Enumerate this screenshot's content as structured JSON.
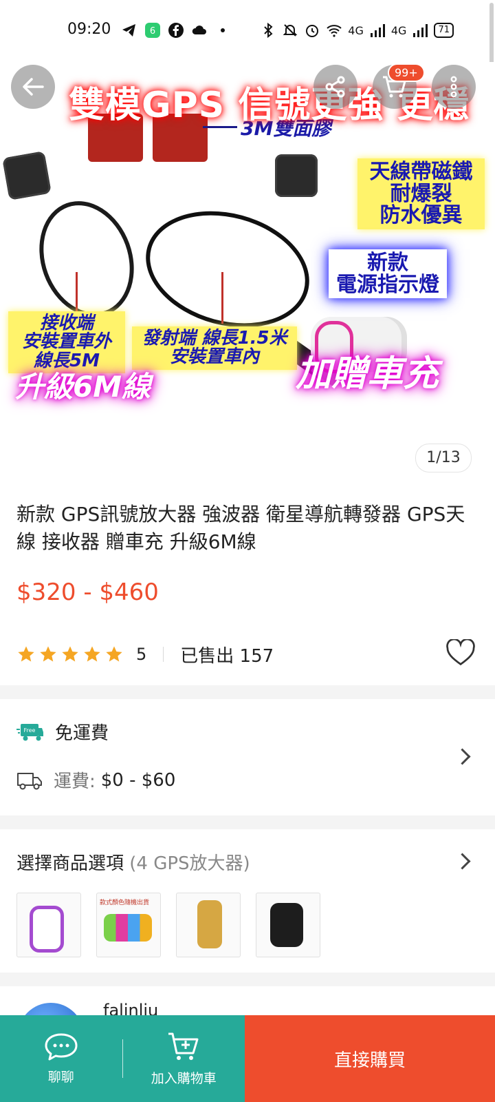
{
  "status_bar": {
    "time": "09:20",
    "battery": "71",
    "network_1": "4G",
    "network_2": "4G"
  },
  "hero": {
    "headline": "雙模GPS 信號更強 更穩",
    "label_tape": "3M雙面膠",
    "label_antenna_lines": [
      "天線帶磁鐵",
      "耐爆裂",
      "防水優異"
    ],
    "label_newlight_lines": [
      "新款",
      "電源指示燈"
    ],
    "label_receive_lines": [
      "接收端",
      "安裝置車外",
      "線長5M"
    ],
    "label_tx_lines": [
      "發射端 線長1.5米",
      "安裝置車內"
    ],
    "label_upgrade": "升級6M線",
    "label_gift": "加贈車充",
    "cart_badge": "99+",
    "image_counter": "1/13"
  },
  "product": {
    "title": "新款 GPS訊號放大器 強波器 衛星導航轉發器 GPS天線 接收器 贈車充 升級6M線",
    "price": "$320 - $460",
    "rating": "5",
    "stars_filled": 5,
    "sold": "已售出 157"
  },
  "shipping": {
    "free_badge": "Free",
    "free_label": "免運費",
    "fee_label": "運費:",
    "fee_value": "$0 - $60"
  },
  "options": {
    "title": "選擇商品選項",
    "count": "(4 GPS放大器)",
    "thumb_2_note": "款式顏色隨機出貨"
  },
  "seller": {
    "name": "falinliu"
  },
  "bottom_bar": {
    "chat_label": "聊聊",
    "add_to_cart_label": "加入購物車",
    "buy_now_label": "直接購買"
  },
  "colors": {
    "accent": "#ee4d2d",
    "teal": "#26aa99",
    "star": "#f5a623"
  }
}
